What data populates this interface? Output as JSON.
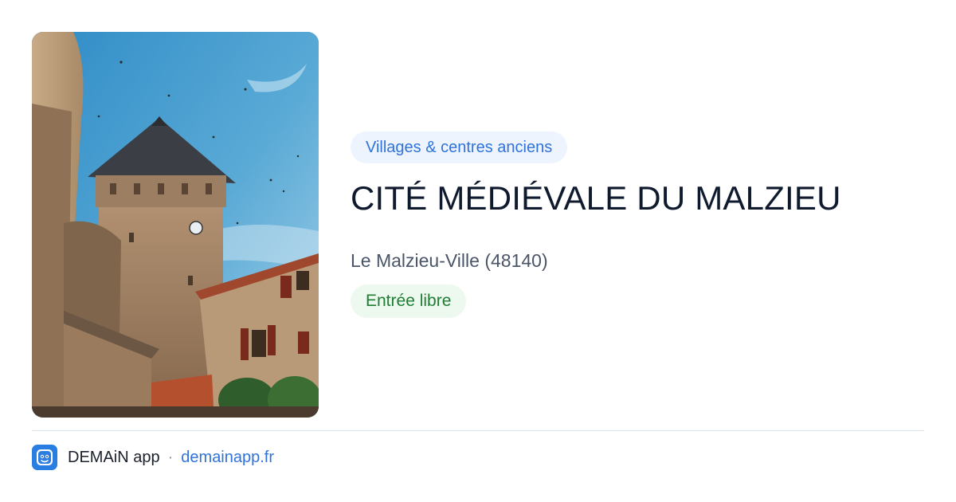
{
  "card": {
    "category": "Villages & centres anciens",
    "title": "CITÉ MÉDIÉVALE DU MALZIEU",
    "location": "Le Malzieu-Ville (48140)",
    "access": "Entrée libre"
  },
  "footer": {
    "app_name": "DEMAiN app",
    "separator": "·",
    "url": "demainapp.fr"
  },
  "photo": {
    "subject": "medieval stone clock tower under blue sky"
  },
  "icons": {
    "app_logo": "demain-app-logo-icon"
  },
  "colors": {
    "accent_blue": "#2f73d9",
    "category_bg": "#eef4fd",
    "access_green": "#1e7e34",
    "access_bg": "#edf8ef",
    "title": "#0f1a2e",
    "logo_blue": "#2a7de1"
  }
}
